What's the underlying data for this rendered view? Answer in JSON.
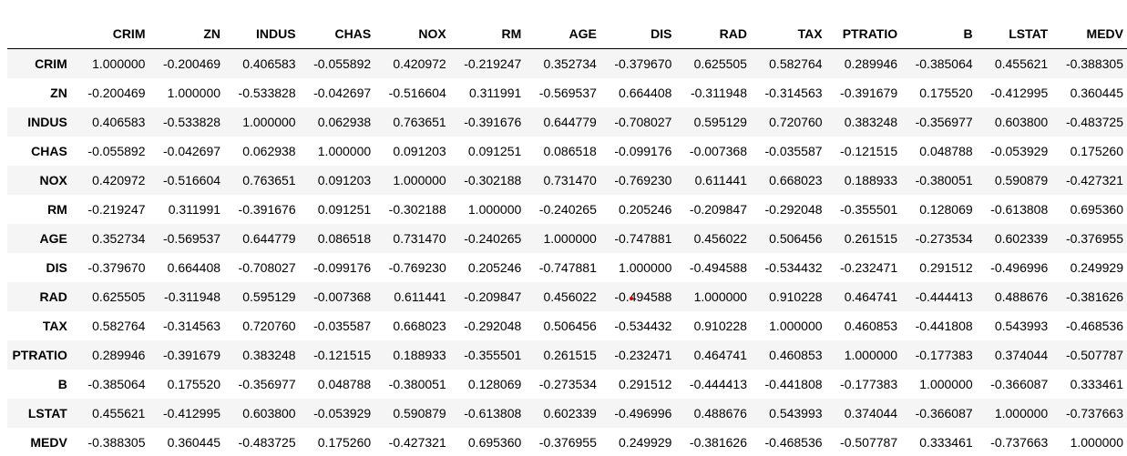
{
  "table": {
    "columns": [
      "CRIM",
      "ZN",
      "INDUS",
      "CHAS",
      "NOX",
      "RM",
      "AGE",
      "DIS",
      "RAD",
      "TAX",
      "PTRATIO",
      "B",
      "LSTAT",
      "MEDV"
    ],
    "rows": [
      {
        "label": "CRIM",
        "values": [
          "1.000000",
          "-0.200469",
          "0.406583",
          "-0.055892",
          "0.420972",
          "-0.219247",
          "0.352734",
          "-0.379670",
          "0.625505",
          "0.582764",
          "0.289946",
          "-0.385064",
          "0.455621",
          "-0.388305"
        ]
      },
      {
        "label": "ZN",
        "values": [
          "-0.200469",
          "1.000000",
          "-0.533828",
          "-0.042697",
          "-0.516604",
          "0.311991",
          "-0.569537",
          "0.664408",
          "-0.311948",
          "-0.314563",
          "-0.391679",
          "0.175520",
          "-0.412995",
          "0.360445"
        ]
      },
      {
        "label": "INDUS",
        "values": [
          "0.406583",
          "-0.533828",
          "1.000000",
          "0.062938",
          "0.763651",
          "-0.391676",
          "0.644779",
          "-0.708027",
          "0.595129",
          "0.720760",
          "0.383248",
          "-0.356977",
          "0.603800",
          "-0.483725"
        ]
      },
      {
        "label": "CHAS",
        "values": [
          "-0.055892",
          "-0.042697",
          "0.062938",
          "1.000000",
          "0.091203",
          "0.091251",
          "0.086518",
          "-0.099176",
          "-0.007368",
          "-0.035587",
          "-0.121515",
          "0.048788",
          "-0.053929",
          "0.175260"
        ]
      },
      {
        "label": "NOX",
        "values": [
          "0.420972",
          "-0.516604",
          "0.763651",
          "0.091203",
          "1.000000",
          "-0.302188",
          "0.731470",
          "-0.769230",
          "0.611441",
          "0.668023",
          "0.188933",
          "-0.380051",
          "0.590879",
          "-0.427321"
        ]
      },
      {
        "label": "RM",
        "values": [
          "-0.219247",
          "0.311991",
          "-0.391676",
          "0.091251",
          "-0.302188",
          "1.000000",
          "-0.240265",
          "0.205246",
          "-0.209847",
          "-0.292048",
          "-0.355501",
          "0.128069",
          "-0.613808",
          "0.695360"
        ]
      },
      {
        "label": "AGE",
        "values": [
          "0.352734",
          "-0.569537",
          "0.644779",
          "0.086518",
          "0.731470",
          "-0.240265",
          "1.000000",
          "-0.747881",
          "0.456022",
          "0.506456",
          "0.261515",
          "-0.273534",
          "0.602339",
          "-0.376955"
        ]
      },
      {
        "label": "DIS",
        "values": [
          "-0.379670",
          "0.664408",
          "-0.708027",
          "-0.099176",
          "-0.769230",
          "0.205246",
          "-0.747881",
          "1.000000",
          "-0.494588",
          "-0.534432",
          "-0.232471",
          "0.291512",
          "-0.496996",
          "0.249929"
        ]
      },
      {
        "label": "RAD",
        "values": [
          "0.625505",
          "-0.311948",
          "0.595129",
          "-0.007368",
          "0.611441",
          "-0.209847",
          "0.456022",
          "-0.494588",
          "1.000000",
          "0.910228",
          "0.464741",
          "-0.444413",
          "0.488676",
          "-0.381626"
        ]
      },
      {
        "label": "TAX",
        "values": [
          "0.582764",
          "-0.314563",
          "0.720760",
          "-0.035587",
          "0.668023",
          "-0.292048",
          "0.506456",
          "-0.534432",
          "0.910228",
          "1.000000",
          "0.460853",
          "-0.441808",
          "0.543993",
          "-0.468536"
        ]
      },
      {
        "label": "PTRATIO",
        "values": [
          "0.289946",
          "-0.391679",
          "0.383248",
          "-0.121515",
          "0.188933",
          "-0.355501",
          "0.261515",
          "-0.232471",
          "0.464741",
          "0.460853",
          "1.000000",
          "-0.177383",
          "0.374044",
          "-0.507787"
        ]
      },
      {
        "label": "B",
        "values": [
          "-0.385064",
          "0.175520",
          "-0.356977",
          "0.048788",
          "-0.380051",
          "0.128069",
          "-0.273534",
          "0.291512",
          "-0.444413",
          "-0.441808",
          "-0.177383",
          "1.000000",
          "-0.366087",
          "0.333461"
        ]
      },
      {
        "label": "LSTAT",
        "values": [
          "0.455621",
          "-0.412995",
          "0.603800",
          "-0.053929",
          "0.590879",
          "-0.613808",
          "0.602339",
          "-0.496996",
          "0.488676",
          "0.543993",
          "0.374044",
          "-0.366087",
          "1.000000",
          "-0.737663"
        ]
      },
      {
        "label": "MEDV",
        "values": [
          "-0.388305",
          "0.360445",
          "-0.483725",
          "0.175260",
          "-0.427321",
          "0.695360",
          "-0.376955",
          "0.249929",
          "-0.381626",
          "-0.468536",
          "-0.507787",
          "0.333461",
          "-0.737663",
          "1.000000"
        ]
      }
    ]
  },
  "cursor": {
    "color": "#e00000"
  }
}
